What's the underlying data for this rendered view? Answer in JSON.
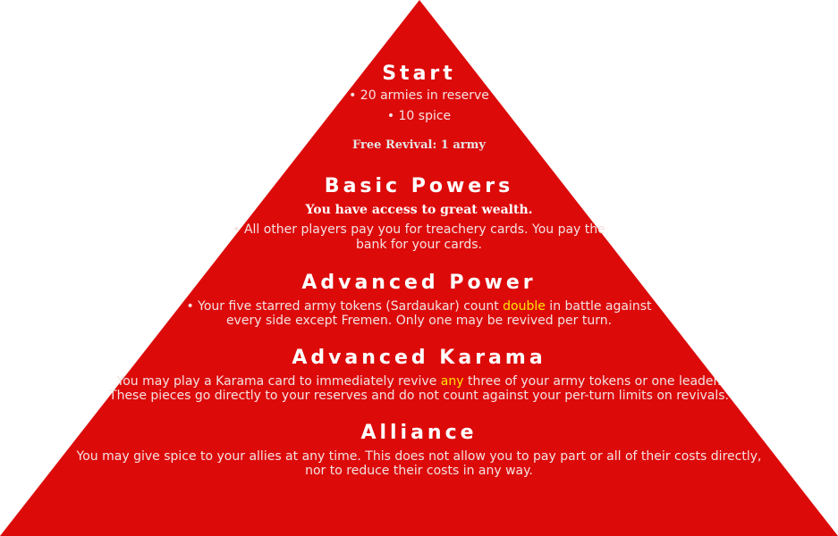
{
  "colors": {
    "pyramid": "#dd0a0a",
    "highlight": "#ffe600",
    "text": "#f4e2e2"
  },
  "start": {
    "title": "Start",
    "items": [
      "• 20 armies in reserve",
      "• 10 spice"
    ],
    "revival": "Free Revival: 1 army"
  },
  "basic": {
    "title": "Basic Powers",
    "subtitle": "You have access to great wealth.",
    "lines": [
      "• All other players pay you for treachery cards. You pay the",
      "bank for your cards."
    ]
  },
  "advanced_power": {
    "title": "Advanced Power",
    "line1_pre": "• Your five starred army tokens (Sardaukar) count ",
    "line1_hl": "double",
    "line1_post": " in battle against",
    "line2": "every side except Fremen. Only one may be revived per turn."
  },
  "karama": {
    "title": "Advanced Karama",
    "line1_pre": "You may play a Karama card to immediately revive ",
    "line1_hl": "any",
    "line1_post": " three of your army tokens or one leader.",
    "line2": "These pieces go directly to your reserves and do not count against your per-turn limits on revivals."
  },
  "alliance": {
    "title": "Alliance",
    "lines": [
      "You may give spice to your allies at any time. This does not allow you to pay part or all of their costs directly,",
      "nor to reduce their costs in any way."
    ]
  }
}
